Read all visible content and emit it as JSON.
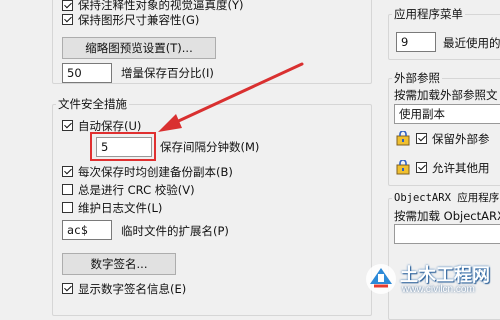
{
  "left_panel": {
    "cb_annotative_fidelity": {
      "label": "保持注释性对象的视觉逼真度(Y)",
      "checked": true
    },
    "cb_drawing_size_compat": {
      "label": "保持图形尺寸兼容性(G)",
      "checked": true
    },
    "thumbnail_button": "缩略图预览设置(T)...",
    "incremental_save_value": "50",
    "incremental_save_label": "增量保存百分比(I)"
  },
  "file_safety": {
    "title": "文件安全措施",
    "autosave": {
      "label": "自动保存(U)",
      "checked": true
    },
    "interval_value": "5",
    "interval_label": "保存间隔分钟数(M)",
    "backup_copy": {
      "label": "每次保存时均创建备份副本(B)",
      "checked": true
    },
    "crc_check": {
      "label": "总是进行 CRC 校验(V)",
      "checked": false
    },
    "log_file": {
      "label": "维护日志文件(L)",
      "checked": false
    },
    "temp_ext_value": "ac$",
    "temp_ext_label": "临时文件的扩展名(P)",
    "digital_sig_button": "数字签名...",
    "show_sig_info": {
      "label": "显示数字签名信息(E)",
      "checked": true
    }
  },
  "right_panel": {
    "app_menu_title": "应用程序菜单",
    "recent_value": "9",
    "recent_label": "最近使用的",
    "xref_title": "外部参照",
    "xref_demand_label": "按需加载外部参照文",
    "xref_select_value": "使用副本",
    "keep_xref_label": "保留外部参",
    "allow_other_label": "允许其他用",
    "arx_title": "ObjectARX 应用程序",
    "arx_demand_label": "按需加载 ObjectARX"
  },
  "watermark": {
    "title": "土木工程网",
    "url": "www.civilcn.com"
  },
  "colors": {
    "highlight_box": "#e03030",
    "arrow": "#d93030"
  }
}
